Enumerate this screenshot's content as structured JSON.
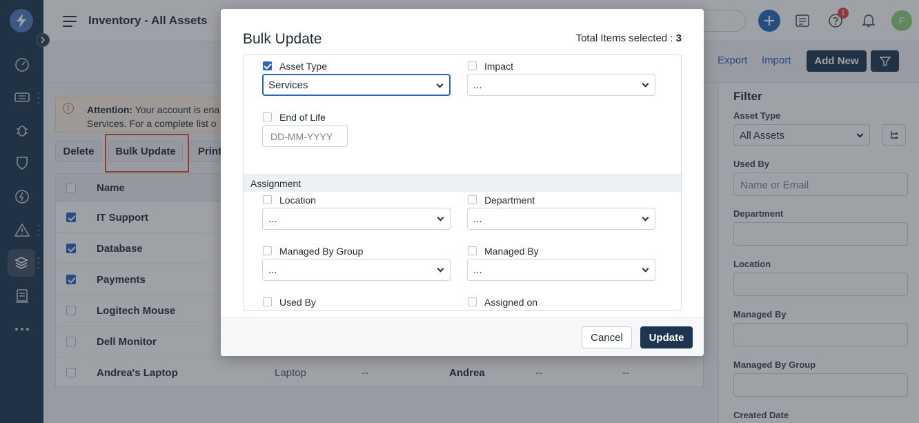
{
  "header": {
    "title": "Inventory - All Assets",
    "help_badge": "1",
    "avatar_initial": "F"
  },
  "toolbar": {
    "export_label": "Export",
    "import_label": "Import",
    "add_new_label": "Add New"
  },
  "attention": {
    "title": "Attention:",
    "line1": "Your account is ena",
    "line2": "Services. For a complete list o"
  },
  "actions": {
    "delete_label": "Delete",
    "bulk_update_label": "Bulk Update",
    "print_label": "Print"
  },
  "table": {
    "name_header": "Name",
    "rows": [
      {
        "name": "IT Support",
        "checked": true,
        "type": "",
        "c3": "",
        "user": "",
        "c5": "",
        "c6": ""
      },
      {
        "name": "Database",
        "checked": true,
        "type": "",
        "c3": "",
        "user": "",
        "c5": "",
        "c6": ""
      },
      {
        "name": "Payments",
        "checked": true,
        "type": "",
        "c3": "",
        "user": "",
        "c5": "",
        "c6": ""
      },
      {
        "name": "Logitech Mouse",
        "checked": false,
        "type": "",
        "c3": "",
        "user": "",
        "c5": "",
        "c6": ""
      },
      {
        "name": "Dell Monitor",
        "checked": false,
        "type": "",
        "c3": "",
        "user": "",
        "c5": "",
        "c6": ""
      },
      {
        "name": "Andrea's Laptop",
        "checked": false,
        "type": "Laptop",
        "c3": "--",
        "user": "Andrea",
        "c5": "--",
        "c6": "--"
      }
    ]
  },
  "filter": {
    "title": "Filter",
    "asset_type_label": "Asset Type",
    "asset_type_value": "All Assets",
    "used_by_label": "Used By",
    "used_by_placeholder": "Name or Email",
    "department_label": "Department",
    "location_label": "Location",
    "managed_by_label": "Managed By",
    "managed_by_group_label": "Managed By Group",
    "created_date_label": "Created Date"
  },
  "modal": {
    "title": "Bulk Update",
    "count_label": "Total Items selected :",
    "count_value": "3",
    "asset_type_label": "Asset Type",
    "asset_type_value": "Services",
    "impact_label": "Impact",
    "impact_value": "...",
    "end_of_life_label": "End of Life",
    "end_of_life_placeholder": "DD-MM-YYYY",
    "assignment_section": "Assignment",
    "location_label": "Location",
    "location_value": "...",
    "department_label": "Department",
    "department_value": "...",
    "managed_by_group_label": "Managed By Group",
    "managed_by_group_value": "...",
    "managed_by_label": "Managed By",
    "managed_by_value": "...",
    "used_by_label": "Used By",
    "assigned_on_label": "Assigned on",
    "cancel_label": "Cancel",
    "update_label": "Update"
  }
}
